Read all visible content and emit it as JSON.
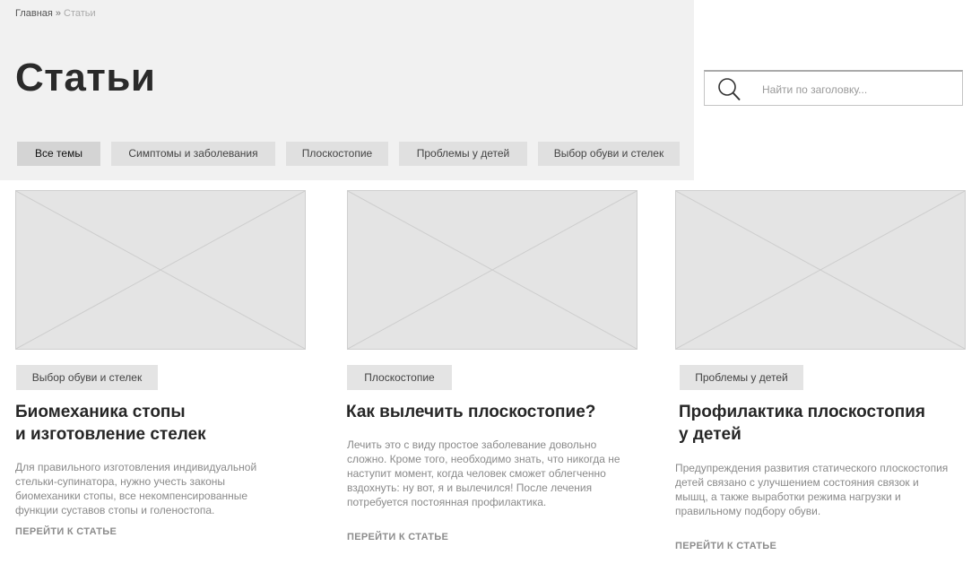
{
  "breadcrumb": {
    "home": "Главная",
    "separator": "»",
    "current": "Статьи"
  },
  "page_title": "Статьи",
  "tabs": [
    {
      "label": "Все темы",
      "active": true
    },
    {
      "label": "Симптомы и заболевания",
      "active": false
    },
    {
      "label": "Плоскостопие",
      "active": false
    },
    {
      "label": "Проблемы у детей",
      "active": false
    },
    {
      "label": "Выбор обуви и стелек",
      "active": false
    }
  ],
  "search": {
    "placeholder": "Найти по заголовку...",
    "value": "",
    "icon": "search-icon"
  },
  "articles": [
    {
      "tag": "Выбор обуви и стелек",
      "title_line1": "Биомеханика стопы",
      "title_line2": "и изготовление стелек",
      "description": "Для правильного изготовления индивидуальной стельки-супинатора, нужно учесть законы биомеханики стопы, все некомпенсированные функции суставов стопы и голеностопа.",
      "link": "ПЕРЕЙТИ К СТАТЬЕ"
    },
    {
      "tag": "Плоскостопие",
      "title_line1": "Как вылечить плоскостопие?",
      "title_line2": "",
      "description": "Лечить это с виду простое заболевание довольно сложно. Кроме того, необходимо знать, что никогда не наступит момент, когда человек сможет облегченно вздохнуть: ну вот, я и вылечился! После лечения потребуется постоянная профилактика.",
      "link": "ПЕРЕЙТИ К СТАТЬЕ"
    },
    {
      "tag": "Проблемы у детей",
      "title_line1": "Профилактика плоскостопия",
      "title_line2": "у детей",
      "description": "Предупреждения развития статического плоскостопия детей связано с улучшением состояния связок и мышц, а также выработки режима нагрузки и правильному подбору обуви.",
      "link": "ПЕРЕЙТИ К СТАТЬЕ"
    }
  ],
  "colors": {
    "hero_background": "#f1f1f1",
    "tab_background": "#e0e0e0",
    "tab_active_background": "#d4d4d4",
    "placeholder_image": "#e4e4e4",
    "title_text": "#262626",
    "muted_text": "#8a8a8a"
  }
}
